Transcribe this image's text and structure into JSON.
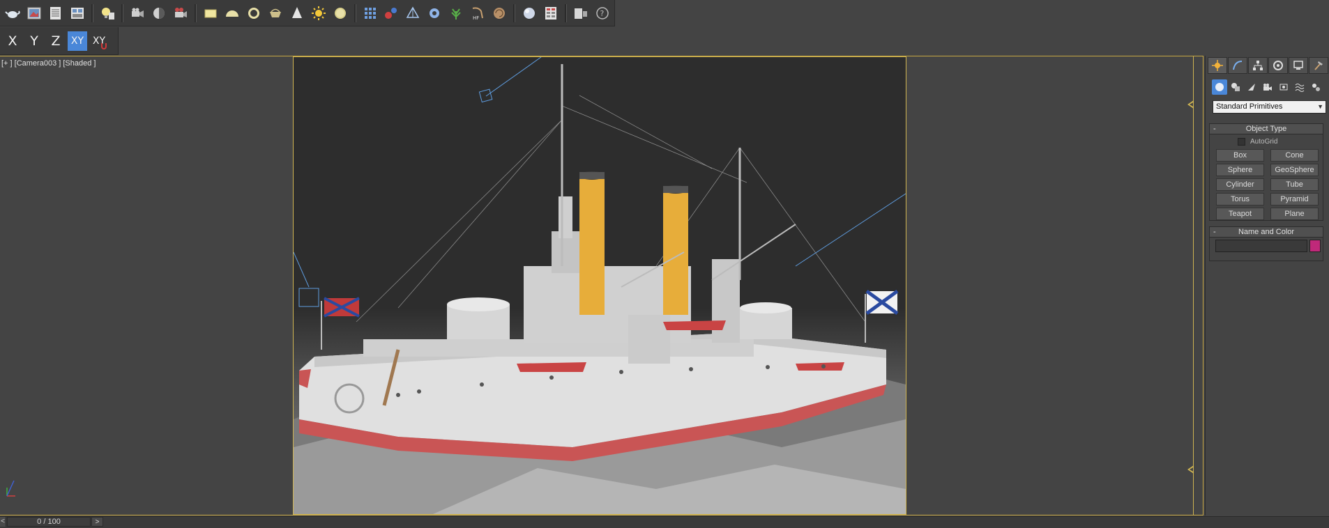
{
  "main_toolbar": {
    "icons": [
      "teapot-icon",
      "render-frame-icon",
      "render-setup-icon",
      "rendered-frame-window-icon",
      "light-lister-icon",
      "camera-icon",
      "shadow-icon",
      "camera-settings-icon",
      "plane-primitive-icon",
      "dome-icon",
      "ring-icon",
      "basket-icon",
      "cone-icon",
      "sun-icon",
      "disc-icon",
      "grid-object-icon",
      "molecule-icon",
      "shape-icon",
      "gear-sphere-icon",
      "plant-icon",
      "hf-icon",
      "shell-icon",
      "sphere-icon",
      "schematic-icon",
      "panel-icon",
      "help-icon"
    ]
  },
  "axis_toolbar": {
    "x": "X",
    "y": "Y",
    "z": "Z",
    "xy": "XY",
    "xy_alt": "XY"
  },
  "viewport": {
    "label": "[+ ] [Camera003 ] [Shaded ]"
  },
  "timeline": {
    "position": "0 / 100",
    "next": ">",
    "prev": "<"
  },
  "command_panel": {
    "dropdown": "Standard Primitives",
    "object_type": {
      "title": "Object Type",
      "autogrid": "AutoGrid",
      "buttons": [
        "Box",
        "Cone",
        "Sphere",
        "GeoSphere",
        "Cylinder",
        "Tube",
        "Torus",
        "Pyramid",
        "Teapot",
        "Plane"
      ]
    },
    "name_and_color": {
      "title": "Name and Color",
      "color": "#c0297a"
    }
  }
}
